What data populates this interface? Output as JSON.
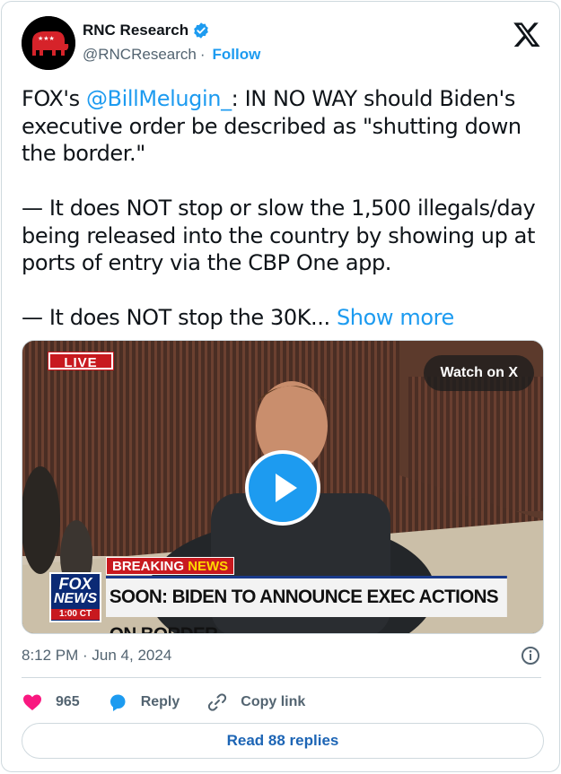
{
  "author": {
    "display_name": "RNC Research",
    "handle": "@RNCResearch",
    "separator": "·",
    "follow_label": "Follow",
    "verified_color": "#1d9bf0",
    "avatar_icon": "gop-elephant-icon"
  },
  "tweet": {
    "line1_prefix": "FOX's ",
    "mention": "@BillMelugin_",
    "line1_rest": ": IN NO WAY should Biden's executive order be described as \"shutting down the border.\"\n\n— It does NOT stop or slow the 1,500 illegals/day being released into the country by showing up at ports of entry via the CBP One app.\n\n— It does NOT stop the 30K... ",
    "show_more": "Show more"
  },
  "media": {
    "live_label": "LIVE",
    "watch_label": "Watch on X",
    "breaking_word1": "BREAKING",
    "breaking_word2": "NEWS",
    "headline": "SOON: BIDEN TO ANNOUNCE EXEC ACTIONS ON BORDER",
    "logo_line1": "FOX",
    "logo_line2": "NEWS",
    "logo_time": "1:00 CT"
  },
  "meta": {
    "timestamp": "8:12 PM · Jun 4, 2024"
  },
  "actions": {
    "like_count": "965",
    "reply_label": "Reply",
    "copy_link_label": "Copy link"
  },
  "footer": {
    "read_replies_label": "Read 88 replies"
  },
  "colors": {
    "accent": "#1d9bf0",
    "like": "#f91880",
    "text_secondary": "#536471"
  }
}
